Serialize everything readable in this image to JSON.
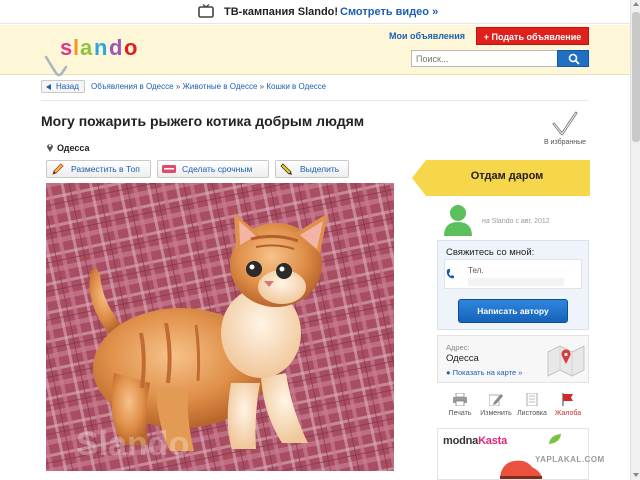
{
  "topbar": {
    "tv_campaign": "ТВ-кампания Slando!",
    "watch_video": "Смотреть видео »"
  },
  "header": {
    "logo_text": "slando",
    "my_ads": "Мои объявления",
    "post_ad": "+ Подать объявление",
    "search_placeholder": "Поиск..."
  },
  "breadcrumb": {
    "back": "Назад",
    "items": [
      "Объявления в Одессе",
      "Животные в Одессе",
      "Кошки в Одессе"
    ],
    "separator": "»"
  },
  "ad": {
    "title": "Могу пожарить рыжего котика добрым людям",
    "favorites_label": "В избранные",
    "city": "Одесса",
    "actions": [
      "Разместить в Топ",
      "Сделать срочным",
      "Выделить"
    ],
    "photo_watermark": "Slando"
  },
  "sidebar": {
    "category_badge": "Отдам даром",
    "user_since": "на Slando с авг. 2012",
    "contact_title": "Свяжитесь со мной:",
    "phone_label": "Тел.",
    "write_author": "Написать автору",
    "address_label": "Адрес:",
    "address_value": "Одесса",
    "show_on_map": "Показать на карте »",
    "tools": [
      "Печать",
      "Изменить",
      "Листовка",
      "Жалоба"
    ],
    "banner_brand_a": "modna",
    "banner_brand_b": "Kasta"
  },
  "page_watermark": "YAPLAKAL.COM",
  "colors": {
    "accent_blue": "#1a5fb4",
    "post_red": "#e0201c",
    "badge_yellow": "#f6d64a",
    "header_bg": "#fdf7d7"
  }
}
